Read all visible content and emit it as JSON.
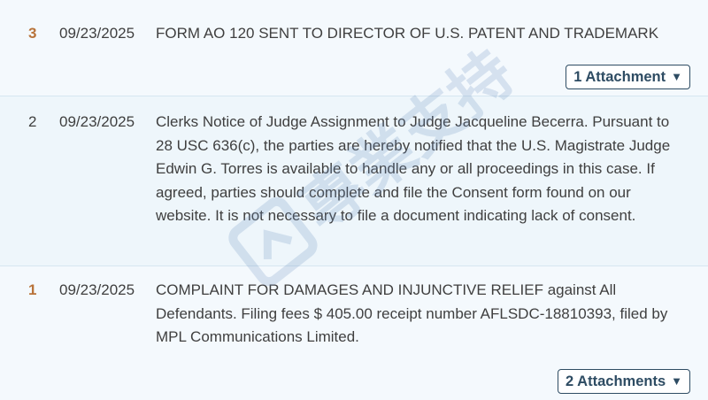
{
  "entries": [
    {
      "number": "3",
      "date": "09/23/2025",
      "text": "FORM AO 120 SENT TO DIRECTOR OF U.S. PATENT AND TRADEMARK",
      "attachment_label": "1 Attachment"
    },
    {
      "number": "2",
      "date": "09/23/2025",
      "text": "Clerks Notice of Judge Assignment to Judge Jacqueline Becerra. Pursuant to 28 USC 636(c), the parties are hereby notified that the U.S. Magistrate Judge Edwin G. Torres is available to handle any or all proceedings in this case. If agreed, parties should complete and file the Consent form found on our website. It is not necessary to file a document indicating lack of consent."
    },
    {
      "number": "1",
      "date": "09/23/2025",
      "text": "COMPLAINT FOR DAMAGES AND INJUNCTIVE RELIEF against All Defendants. Filing fees $ 405.00 receipt number AFLSDC-18810393, filed by MPL Communications Limited.",
      "attachment_label": "2 Attachments"
    }
  ],
  "watermark": {
    "text": "專業支持",
    "color": "#6a8fbf"
  },
  "colors": {
    "accent_number": "#b8733a",
    "button_border": "#2e4c63",
    "row_shaded": "#eef6fb"
  }
}
